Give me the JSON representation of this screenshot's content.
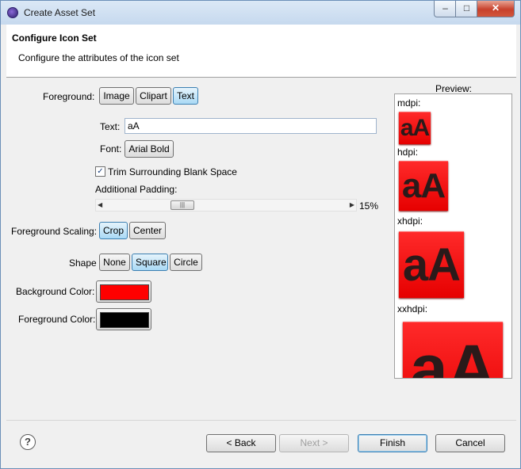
{
  "window": {
    "title": "Create Asset Set",
    "min_label": "–",
    "max_label": "□",
    "close_label": "✕"
  },
  "header": {
    "title": "Configure Icon Set",
    "description": "Configure the attributes of the icon set"
  },
  "form": {
    "foreground_label": "Foreground:",
    "foreground_options": [
      "Image",
      "Clipart",
      "Text"
    ],
    "foreground_selected": "Text",
    "text_label": "Text:",
    "text_value": "aA",
    "font_label": "Font:",
    "font_button": "Arial Bold",
    "trim_label": "Trim Surrounding Blank Space",
    "trim_checked": true,
    "check_glyph": "✓",
    "padding_label": "Additional Padding:",
    "padding_value": "15%",
    "slider_left_arrow": "◀",
    "slider_right_arrow": "▶",
    "slider_grip": "|||",
    "scaling_label": "Foreground Scaling:",
    "scaling_options": [
      "Crop",
      "Center"
    ],
    "scaling_selected": "Crop",
    "shape_label": "Shape",
    "shape_options": [
      "None",
      "Square",
      "Circle"
    ],
    "shape_selected": "Square",
    "background_color_label": "Background Color:",
    "background_color": "#ff0000",
    "foreground_color_label": "Foreground Color:",
    "foreground_color": "#000000"
  },
  "preview": {
    "label": "Preview:",
    "icon_text": "aA",
    "densities": [
      "mdpi:",
      "hdpi:",
      "xhdpi:",
      "xxhdpi:"
    ]
  },
  "footer": {
    "help_icon": "?",
    "back": "< Back",
    "next": "Next >",
    "finish": "Finish",
    "cancel": "Cancel"
  },
  "colors": {
    "accent_selected": "#a9d9f5",
    "icon_red": "#ff0000"
  }
}
